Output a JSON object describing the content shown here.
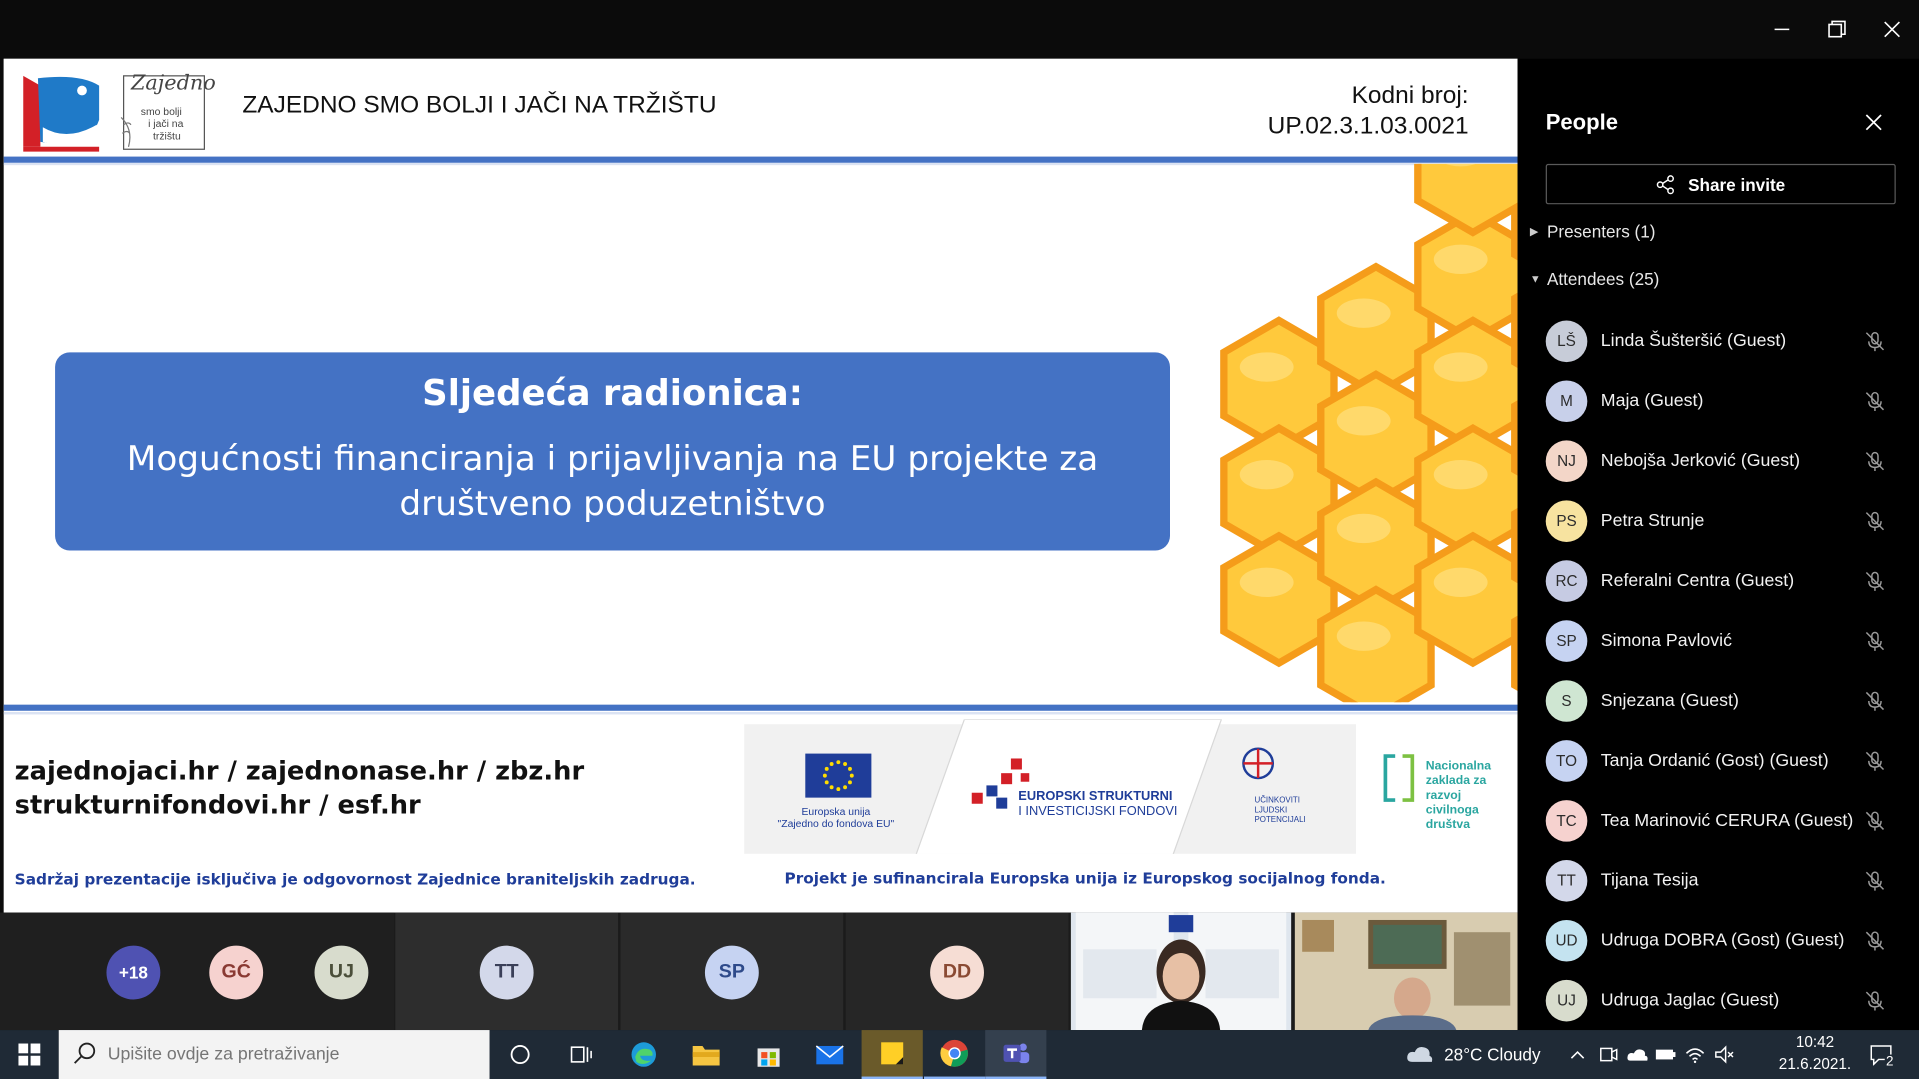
{
  "window": {
    "controls": [
      "minimize",
      "restore",
      "close"
    ]
  },
  "slide": {
    "header_title": "ZAJEDNO SMO BOLJI I JAČI NA TRŽIŠTU",
    "logo_text": [
      "Zajedno",
      "smo bolji",
      "i jači na",
      "tržištu"
    ],
    "code_label": "Kodni broj:",
    "code_value": "UP.02.3.1.03.0021",
    "box_heading": "Sljedeća radionica:",
    "box_text": "Mogućnosti financiranja i prijavljivanja na EU projekte za društveno poduzetništvo",
    "footer_links_line1": "zajednojaci.hr / zajednonase.hr / zbz.hr",
    "footer_links_line2": "strukturnifondovi.hr / esf.hr",
    "footer_note_left": "Sadržaj prezentacije isključiva je odgovornost Zajednice braniteljskih zadruga.",
    "footer_note_right": "Projekt je sufinancirala Europska unija iz Europskog socijalnog fonda.",
    "eu_caption_1": "Europska unija",
    "eu_caption_2": "\"Zajedno do fondova EU\"",
    "esif_line1": "EUROPSKI STRUKTURNI",
    "esif_line2": "I INVESTICIJSKI FONDOVI",
    "esf_lines": [
      "UČINKOVITI",
      "LJUDSKI",
      "POTENCIJALI"
    ],
    "nz_lines": [
      "Nacionalna",
      "zaklada za",
      "razvoj",
      "civilnoga",
      "društva"
    ]
  },
  "gallery": {
    "overflow": "+18",
    "tiles": [
      "GĆ",
      "UJ",
      "TT",
      "SP",
      "DD"
    ]
  },
  "people": {
    "title": "People",
    "share_label": "Share invite",
    "presenters": "Presenters (1)",
    "attendees": "Attendees (25)",
    "list": [
      {
        "initials": "LŠ",
        "name": "Linda Šušteršić (Guest)",
        "color": "#c7ccd8"
      },
      {
        "initials": "M",
        "name": "Maja (Guest)",
        "color": "#c8d0ea"
      },
      {
        "initials": "NJ",
        "name": "Nebojša Jerković (Guest)",
        "color": "#f3d6c8"
      },
      {
        "initials": "PS",
        "name": "Petra Strunje",
        "color": "#f7e3a0"
      },
      {
        "initials": "RC",
        "name": "Referalni Centra (Guest)",
        "color": "#c6cbe3"
      },
      {
        "initials": "SP",
        "name": "Simona Pavlović",
        "color": "#c6d3f2"
      },
      {
        "initials": "S",
        "name": "Snjezana (Guest)",
        "color": "#cfe6d2"
      },
      {
        "initials": "TO",
        "name": "Tanja Ordanić (Gost) (Guest)",
        "color": "#c6d3f2"
      },
      {
        "initials": "TC",
        "name": "Tea Marinović CERURA (Guest)",
        "color": "#f6d2cf"
      },
      {
        "initials": "TT",
        "name": "Tijana Tesija",
        "color": "#d3d8ea"
      },
      {
        "initials": "UD",
        "name": "Udruga DOBRA (Gost) (Guest)",
        "color": "#c4e3f0"
      },
      {
        "initials": "UJ",
        "name": "Udruga Jaglac (Guest)",
        "color": "#d8dccd"
      }
    ]
  },
  "taskbar": {
    "search_placeholder": "Upišite ovdje za pretraživanje",
    "weather": "28°C  Cloudy",
    "time": "10:42",
    "date": "21.6.2021.",
    "notifications": "2"
  }
}
